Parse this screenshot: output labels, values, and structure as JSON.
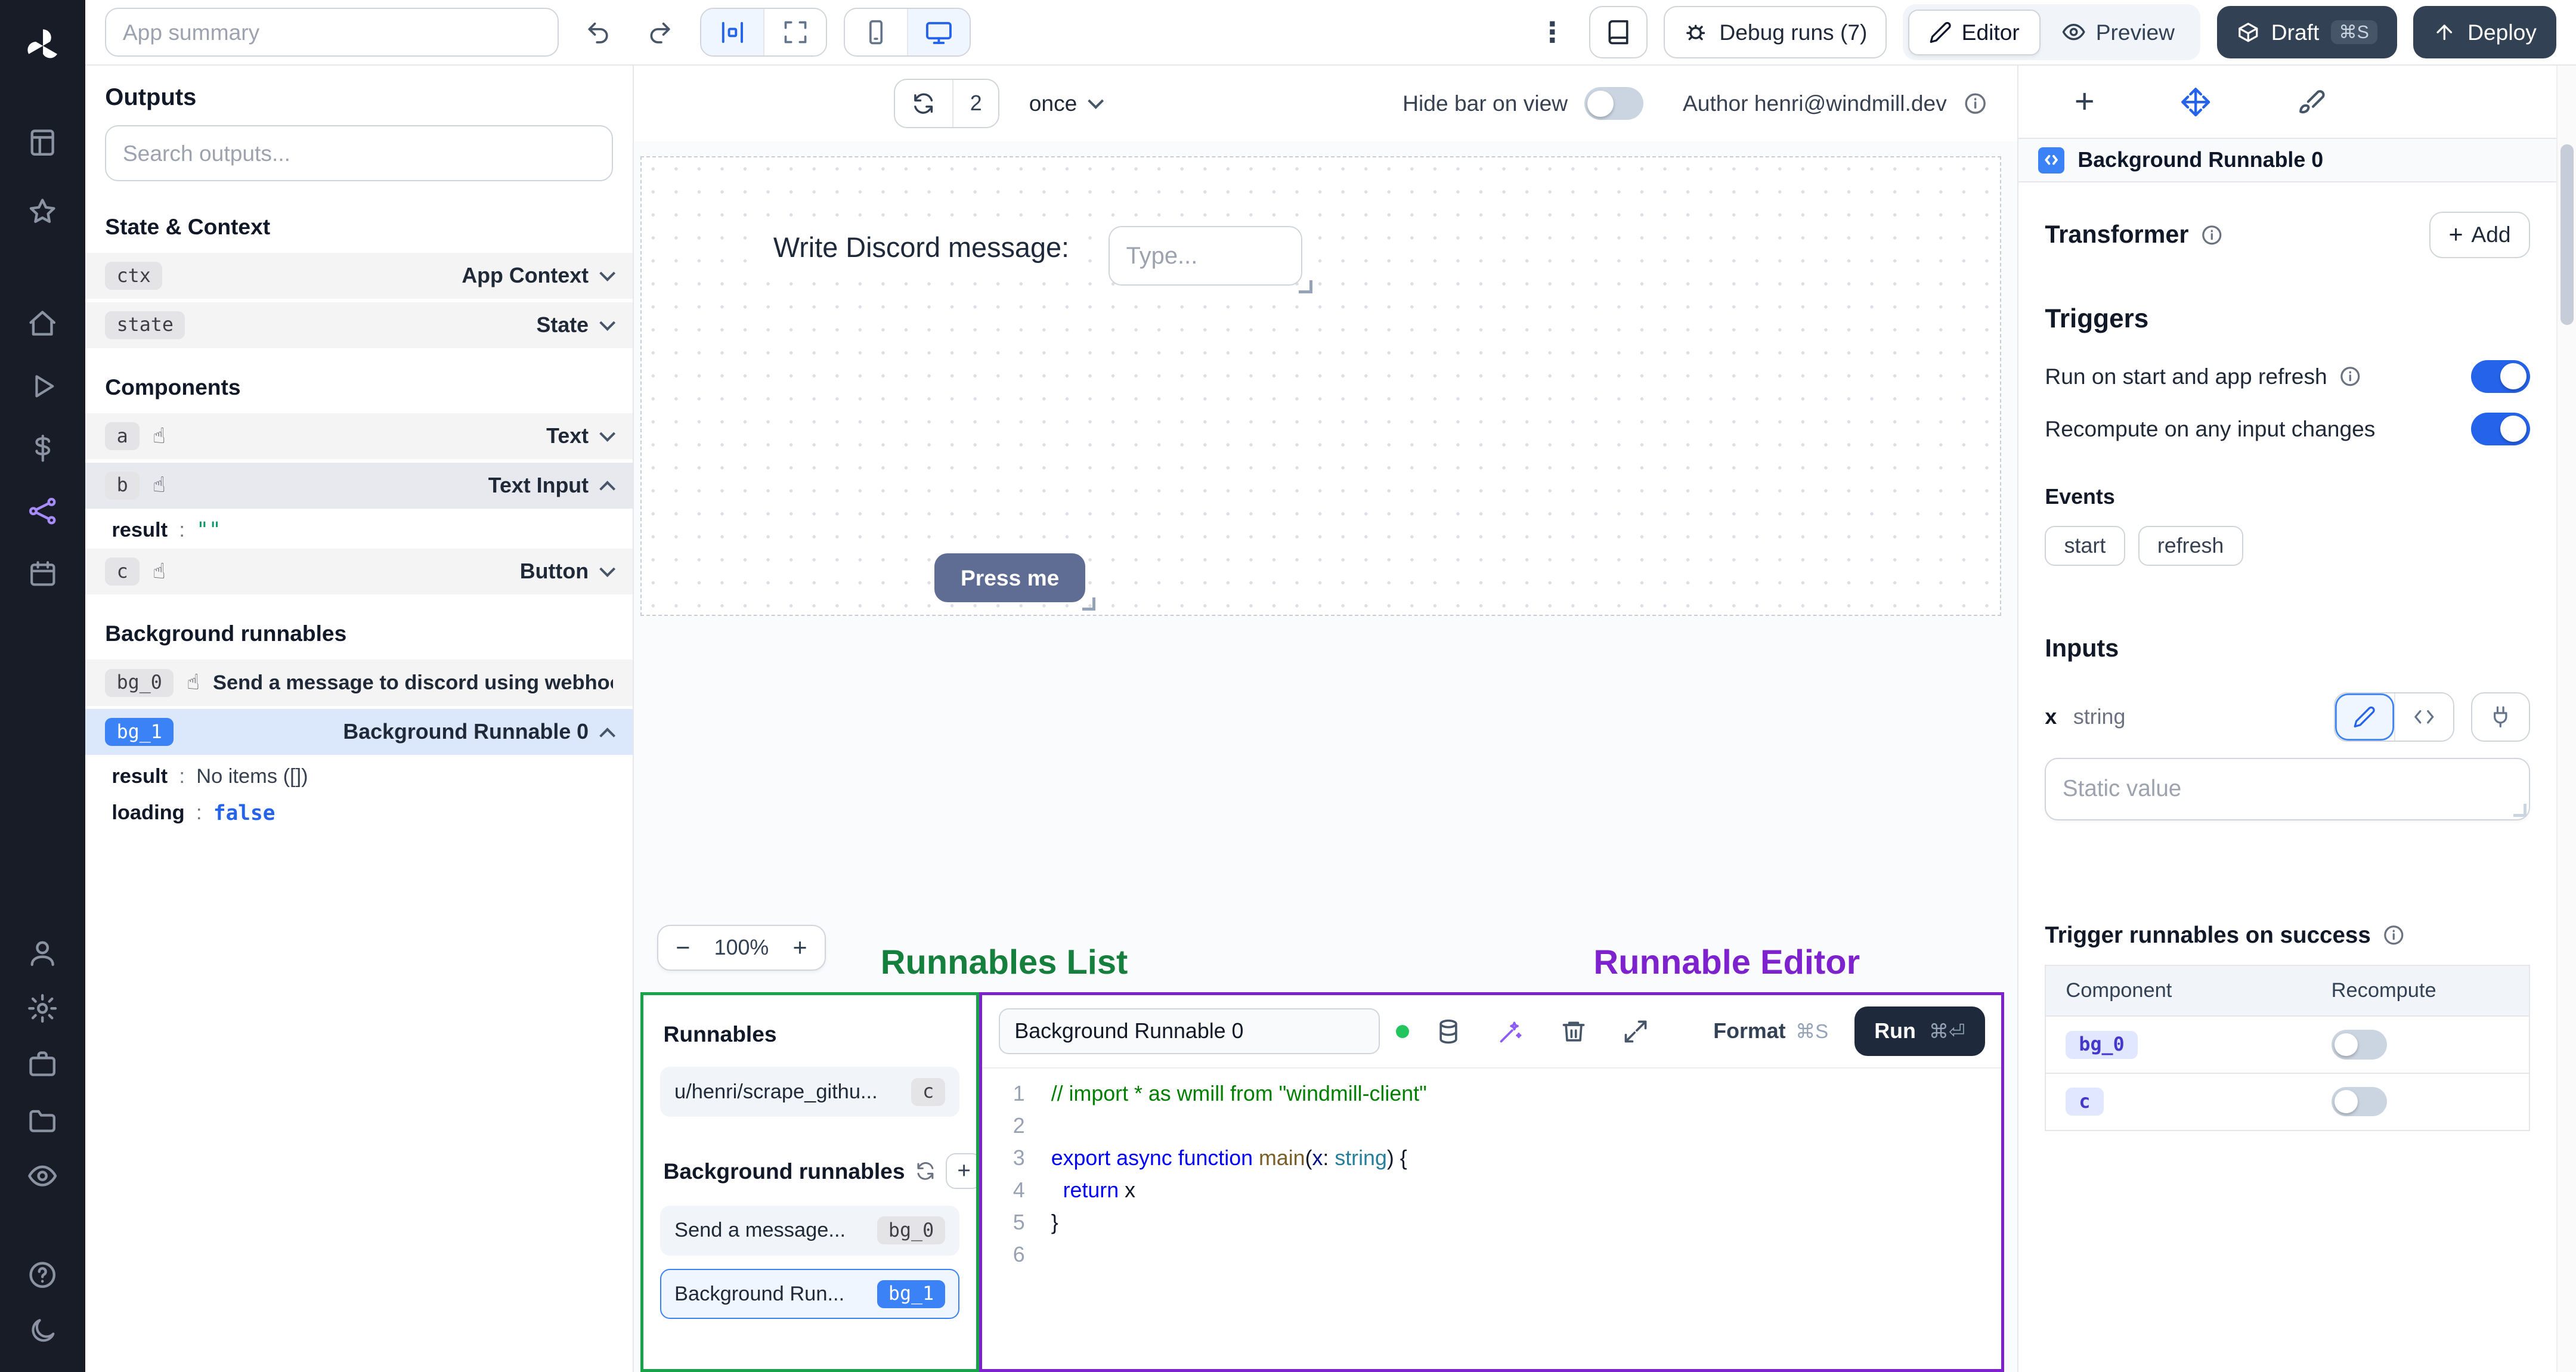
{
  "colors": {
    "accent_blue": "#2563eb",
    "toggle_on": "#2563eb",
    "annotation_green": "#15803d",
    "annotation_purple": "#7e22ce",
    "badge_blue": "#3b82f6"
  },
  "ui": {
    "colon": ":"
  },
  "annotations": {
    "runnables_list": "Runnables List",
    "runnable_editor": "Runnable Editor"
  },
  "topbar": {
    "app_summary_placeholder": "App summary",
    "debug_runs_label": "Debug runs (7)",
    "editor_label": "Editor",
    "preview_label": "Preview",
    "draft_label": "Draft",
    "draft_shortcut": "⌘S",
    "deploy_label": "Deploy"
  },
  "outputs": {
    "title": "Outputs",
    "search_placeholder": "Search outputs...",
    "state_context_title": "State & Context",
    "ctx_badge": "ctx",
    "ctx_label": "App Context",
    "state_badge": "state",
    "state_label": "State",
    "components_title": "Components",
    "comp_a_badge": "a",
    "comp_a_label": "Text",
    "comp_b_badge": "b",
    "comp_b_label": "Text Input",
    "comp_b_result_key": "result",
    "comp_b_result_value": "\"\"",
    "comp_c_badge": "c",
    "comp_c_label": "Button",
    "background_title": "Background runnables",
    "bg0_badge": "bg_0",
    "bg0_label": "Send a message to discord using webhoo",
    "bg1_badge": "bg_1",
    "bg1_label": "Background Runnable 0",
    "bg1_result_key": "result",
    "bg1_result_value": "No items ([])",
    "bg1_loading_key": "loading",
    "bg1_loading_value": "false"
  },
  "canvas": {
    "refresh_count": "2",
    "interval_label": "once",
    "hide_bar_label": "Hide bar on view",
    "author_label": "Author henri@windmill.dev",
    "discord_text": "Write Discord message:",
    "type_placeholder": "Type...",
    "press_me_label": "Press me",
    "zoom_out": "−",
    "zoom_level": "100%",
    "zoom_in": "+"
  },
  "runnables": {
    "title": "Runnables",
    "item_script_name": "u/henri/scrape_githu...",
    "item_script_badge": "c",
    "background_title": "Background runnables",
    "item_bg0_name": "Send a message...",
    "item_bg0_badge": "bg_0",
    "item_bg1_name": "Background Run...",
    "item_bg1_badge": "bg_1"
  },
  "editor": {
    "title": "Background Runnable 0",
    "format_label": "Format",
    "format_shortcut": "⌘S",
    "run_label": "Run",
    "run_shortcut": "⌘⏎",
    "code": [
      {
        "n": "1",
        "tokens": [
          {
            "t": "// import * as wmill from \"windmill-client\"",
            "c": "comment"
          }
        ]
      },
      {
        "n": "2",
        "tokens": []
      },
      {
        "n": "3",
        "tokens": [
          {
            "t": "export",
            "c": "keyword"
          },
          {
            "t": " ",
            "c": "plain"
          },
          {
            "t": "async",
            "c": "keyword"
          },
          {
            "t": " ",
            "c": "plain"
          },
          {
            "t": "function",
            "c": "keyword"
          },
          {
            "t": " ",
            "c": "plain"
          },
          {
            "t": "main",
            "c": "func"
          },
          {
            "t": "(",
            "c": "plain"
          },
          {
            "t": "x",
            "c": "var"
          },
          {
            "t": ": ",
            "c": "plain"
          },
          {
            "t": "string",
            "c": "type"
          },
          {
            "t": ") {",
            "c": "plain"
          }
        ]
      },
      {
        "n": "4",
        "tokens": [
          {
            "t": "  ",
            "c": "plain"
          },
          {
            "t": "return",
            "c": "keyword"
          },
          {
            "t": " x",
            "c": "plain"
          }
        ]
      },
      {
        "n": "5",
        "tokens": [
          {
            "t": "}",
            "c": "plain"
          }
        ]
      },
      {
        "n": "6",
        "tokens": []
      }
    ]
  },
  "right": {
    "header_title": "Background Runnable 0",
    "transformer_title": "Transformer",
    "add_label": "Add",
    "triggers_title": "Triggers",
    "trigger_start_label": "Run on start and app refresh",
    "trigger_recompute_label": "Recompute on any input changes",
    "events_title": "Events",
    "event_start": "start",
    "event_refresh": "refresh",
    "inputs_title": "Inputs",
    "input_name": "x",
    "input_type": "string",
    "static_value_placeholder": "Static value",
    "success_title": "Trigger runnables on success",
    "success_table": {
      "col_component": "Component",
      "col_recompute": "Recompute",
      "rows": [
        {
          "component": "bg_0"
        },
        {
          "component": "c"
        }
      ]
    }
  }
}
